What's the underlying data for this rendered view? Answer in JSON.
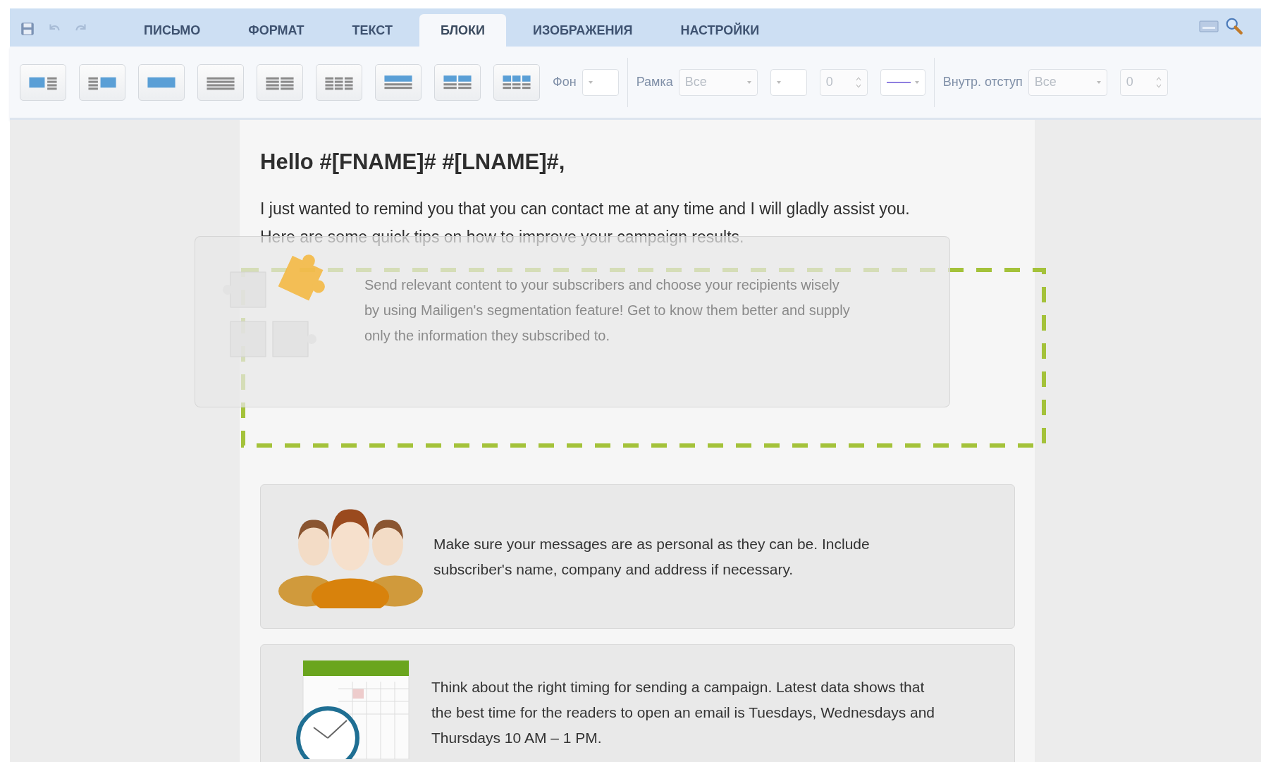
{
  "toolbar_icons": [
    {
      "kind": "save",
      "disabled": false
    },
    {
      "kind": "undo",
      "disabled": true
    },
    {
      "kind": "redo",
      "disabled": true
    }
  ],
  "tabs": [
    {
      "label": "ПИСЬМО",
      "selected": false
    },
    {
      "label": "ФОРМАТ",
      "selected": false
    },
    {
      "label": "ТЕКСТ",
      "selected": false
    },
    {
      "label": "БЛОКИ",
      "selected": true
    },
    {
      "label": "ИЗОБРАЖЕНИЯ",
      "selected": false
    },
    {
      "label": "НАСТРОЙКИ",
      "selected": false
    }
  ],
  "layout_buttons": [
    {
      "kind": "image-text"
    },
    {
      "kind": "text-image"
    },
    {
      "kind": "image"
    },
    {
      "kind": "text"
    },
    {
      "kind": "text-2"
    },
    {
      "kind": "text-3"
    },
    {
      "kind": "image-over-text"
    },
    {
      "kind": "image-over-text-2"
    },
    {
      "kind": "image-over-text-3"
    }
  ],
  "controls": [
    {
      "kind": "label",
      "text": "Фон"
    },
    {
      "kind": "select"
    },
    {
      "kind": "separator"
    },
    {
      "kind": "label",
      "text": "Рамка"
    },
    {
      "kind": "select",
      "value": "Все",
      "disabled": true
    },
    {
      "kind": "select"
    },
    {
      "kind": "spinner",
      "value": "0",
      "disabled": true
    },
    {
      "kind": "line-select"
    },
    {
      "kind": "separator"
    },
    {
      "kind": "label",
      "text": "Внутр. отступ"
    },
    {
      "kind": "select",
      "value": "Все",
      "disabled": true
    },
    {
      "kind": "spinner",
      "value": "0",
      "disabled": true
    }
  ],
  "email": {
    "heading": "Hello #[FNAME]# #[LNAME]#,",
    "paragraphs": [
      "I just wanted to remind you that you can contact me at any time and I will gladly assist you.",
      "Here are some quick tips on how to improve your campaign results."
    ],
    "dragged_block": {
      "kind": "puzzle",
      "text": "Send relevant content to your subscribers and choose your recipients wisely by using Mailigen's segmentation feature! Get to know them better and supply only the information they subscribed to."
    },
    "blocks": [
      {
        "kind": "people",
        "text": "Make sure your messages are as personal as they can be. Include subscriber's name, company and address if necessary."
      },
      {
        "kind": "calendar",
        "text": "Think about the right timing for sending a campaign. Latest data shows that the best time for the readers to open an email is Tuesdays, Wednesdays and Thursdays 10 AM – 1 PM."
      }
    ]
  }
}
